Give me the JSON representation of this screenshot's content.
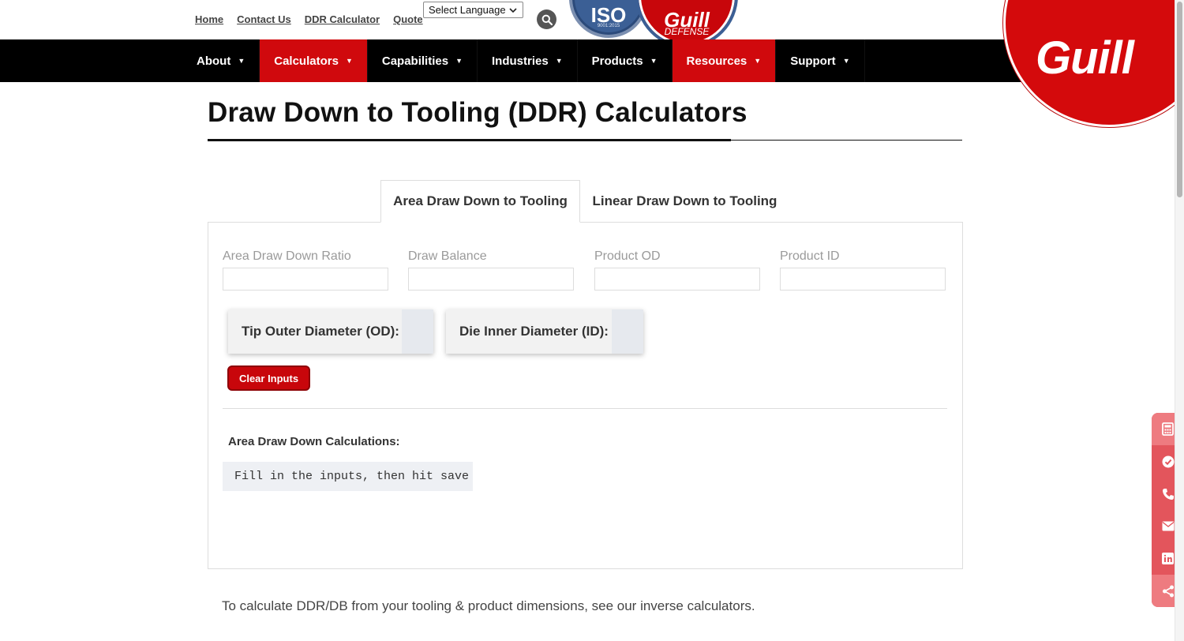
{
  "top_links": [
    "Home",
    "Contact Us",
    "DDR Calculator",
    "Quote"
  ],
  "language_select": {
    "value": "Select Language"
  },
  "badges": {
    "iso": {
      "title": "ISO",
      "sub": "9001:2015"
    },
    "guill_defense": {
      "title": "Guill",
      "sub": "DEFENSE"
    }
  },
  "logo_text": "Guill",
  "nav": [
    {
      "label": "About",
      "active": false
    },
    {
      "label": "Calculators",
      "active": true
    },
    {
      "label": "Capabilities",
      "active": false
    },
    {
      "label": "Industries",
      "active": false
    },
    {
      "label": "Products",
      "active": false
    },
    {
      "label": "Resources",
      "active": true
    },
    {
      "label": "Support",
      "active": false
    }
  ],
  "page_title": "Draw Down to Tooling (DDR) Calculators",
  "tabs": {
    "active": "Area Draw Down to Tooling",
    "inactive": "Linear Draw Down to Tooling"
  },
  "fields": [
    {
      "label": "Area Draw Down Ratio",
      "value": ""
    },
    {
      "label": "Draw Balance",
      "value": ""
    },
    {
      "label": "Product OD",
      "value": ""
    },
    {
      "label": "Product ID",
      "value": ""
    }
  ],
  "results": {
    "tip_od": {
      "label": "Tip Outer Diameter (OD):",
      "value": ""
    },
    "die_id": {
      "label": "Die Inner Diameter (ID):",
      "value": ""
    }
  },
  "clear_button": "Clear Inputs",
  "calculations": {
    "heading": "Area Draw Down Calculations:",
    "output": "Fill in the inputs, then hit save"
  },
  "footer_note": "To calculate DDR/DB from your tooling & product dimensions, see our inverse calculators.",
  "side_buttons": [
    "calculator-icon",
    "check-circle-icon",
    "phone-icon",
    "envelope-icon",
    "linkedin-icon",
    "share-icon"
  ],
  "colors": {
    "brand_red": "#d0090d",
    "nav_black": "#000000",
    "side_red": "#e3555c"
  }
}
